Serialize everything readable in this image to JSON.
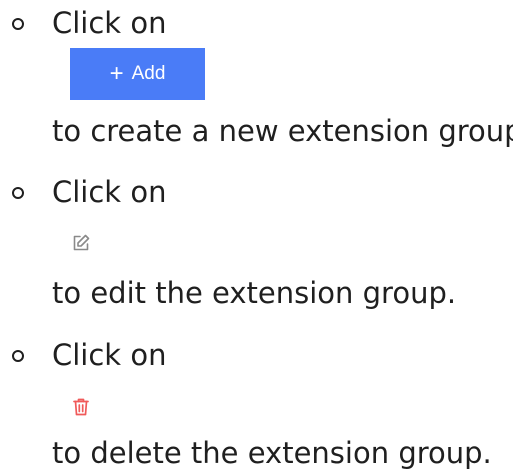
{
  "steps": [
    {
      "lead_text": "Click on",
      "control": {
        "type": "button",
        "icon": "plus-icon",
        "label": "Add",
        "color": "#4a7cf7"
      },
      "trail_text": "to create a new extension group."
    },
    {
      "lead_text": "Click on",
      "control": {
        "type": "icon",
        "icon": "edit-icon",
        "color": "#8a8a8a"
      },
      "trail_text": "to edit the extension group."
    },
    {
      "lead_text": "Click on",
      "control": {
        "type": "icon",
        "icon": "trash-icon",
        "color": "#f05a5a"
      },
      "trail_text": "to delete the extension group."
    }
  ]
}
